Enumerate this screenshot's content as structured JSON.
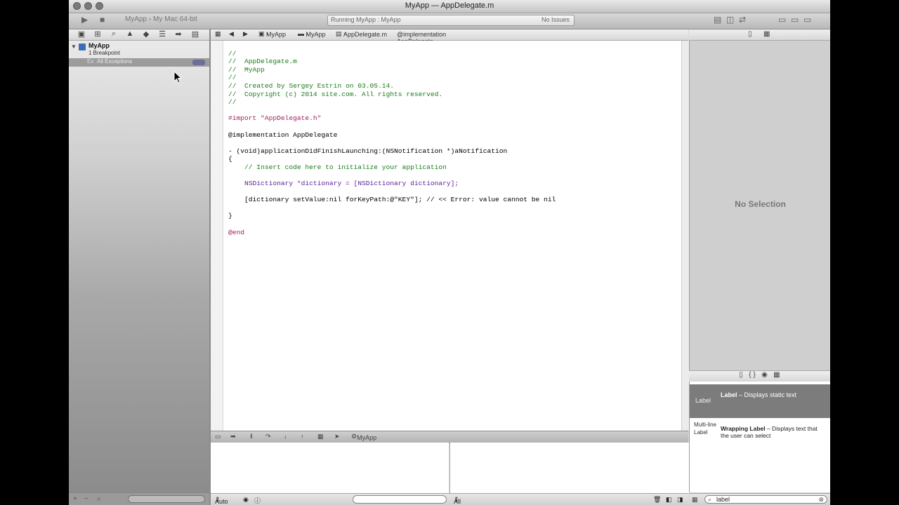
{
  "window": {
    "title": "MyApp — AppDelegate.m",
    "colors": {
      "chrome": "#d9d9d9",
      "editor_bg": "#ffffff",
      "comment": "#1a7d1a",
      "keyword": "#a0205f",
      "string": "#b2222a"
    }
  },
  "toolbar": {
    "run_icon": "play-icon",
    "stop_icon": "stop-icon",
    "scheme": "MyApp",
    "destination": "My Mac 64-bit",
    "activity_status": "Running MyApp : MyApp",
    "issues": "No Issues"
  },
  "navigator": {
    "project_name": "MyApp",
    "breakpoint_count": "1 Breakpoint",
    "exception_prefix": "Ex",
    "exception_label": "All Exceptions"
  },
  "jumpbar": {
    "back_icon": "◀",
    "forward_icon": "▶",
    "crumbs": [
      "MyApp",
      "MyApp",
      "AppDelegate.m",
      "@implementation AppDelegate"
    ]
  },
  "editor": {
    "lines": [
      "//",
      "//  AppDelegate.m",
      "//  MyApp",
      "//",
      "//  Created by Sergey Estrin on 03.05.14.",
      "//  Copyright (c) 2014 site.com. All rights reserved.",
      "//",
      "",
      "#import \"AppDelegate.h\"",
      "",
      "@implementation AppDelegate",
      "",
      "- (void)applicationDidFinishLaunching:(NSNotification *)aNotification",
      "{",
      "    // Insert code here to initialize your application",
      "",
      "    NSDictionary *dictionary = [NSDictionary dictionary];",
      "",
      "    [dictionary setValue:nil forKeyPath:@\"KEY\"]; // << Error: value cannot be nil",
      "",
      "}",
      "",
      "@end"
    ]
  },
  "debug": {
    "scope_label": "Auto",
    "output_label": "All Output",
    "target": "MyApp"
  },
  "inspector": {
    "no_selection": "No Selection"
  },
  "library": {
    "items": [
      {
        "badge": "Label",
        "title": "Label",
        "desc": "Displays static text"
      },
      {
        "badge": "Multi-line Label",
        "title": "Wrapping Label",
        "desc": " – Displays text that the user can select"
      }
    ],
    "filter_value": "label"
  }
}
